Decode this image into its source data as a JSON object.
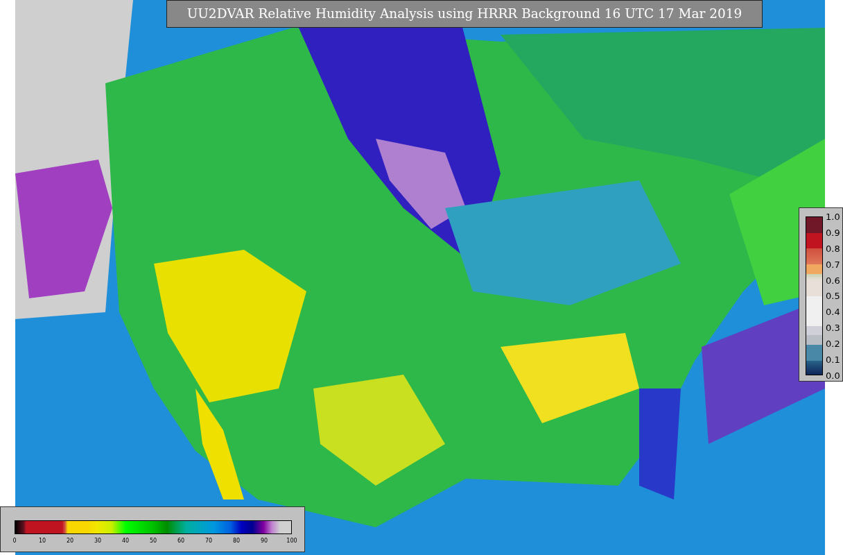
{
  "title": "UU2DVAR Relative Humidity Analysis using HRRR Background 16 UTC 17 Mar 2019",
  "humidity_colorbar": {
    "ticks": [
      "0",
      "10",
      "20",
      "30",
      "40",
      "50",
      "60",
      "70",
      "80",
      "90",
      "100"
    ]
  },
  "observation_colorbar": {
    "ticks": [
      "1.0",
      "0.9",
      "0.8",
      "0.7",
      "0.6",
      "0.5",
      "0.4",
      "0.3",
      "0.2",
      "0.1",
      "0.0"
    ]
  }
}
